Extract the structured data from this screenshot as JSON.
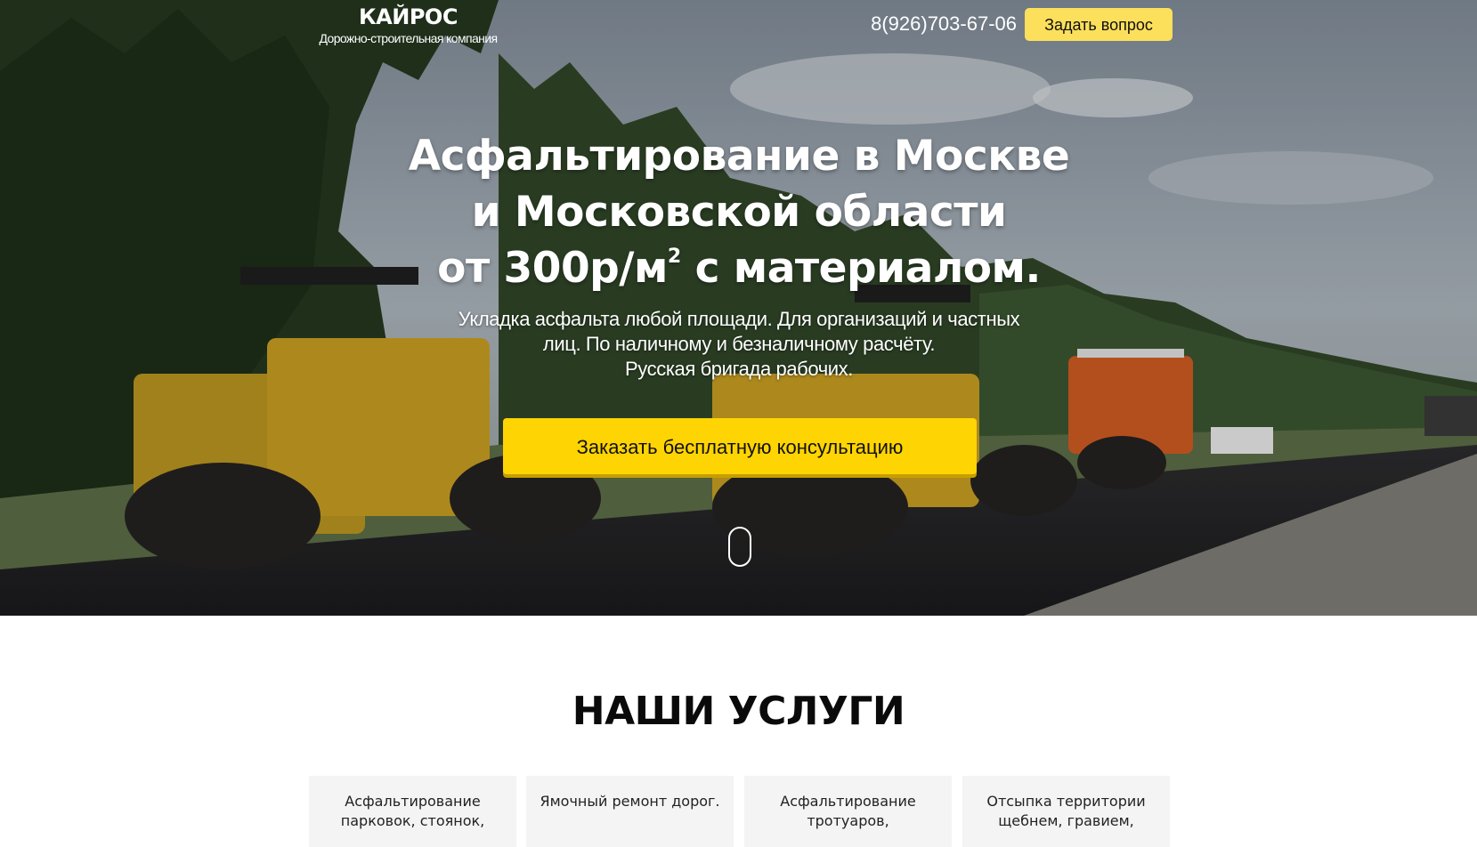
{
  "header": {
    "logo_name": "КАЙРОС",
    "logo_tagline": "Дорожно-строительная компания",
    "phone": "8(926)703-67-06",
    "ask_button": "Задать вопрос"
  },
  "hero": {
    "title_line1": "Асфальтирование  в Москве",
    "title_line2": "и  Московской области",
    "title_line3_prefix": "от 300р/м",
    "title_line3_sup": "2",
    "title_line3_suffix": " с материалом.",
    "subtitle_line1": "Укладка асфальта любой площади. Для организаций и частных",
    "subtitle_line2": "лиц. По наличному и безналичному расчёту.",
    "subtitle_line3": "Русская бригада рабочих.",
    "cta_button": "Заказать бесплатную консультацию",
    "background_description_icon": "road-rollers-photo"
  },
  "services": {
    "title": "НАШИ УСЛУГИ",
    "cards": [
      {
        "line1": "Асфальтирование",
        "line2": "парковок, стоянок,"
      },
      {
        "line1": "Ямочный ремонт дорог.",
        "line2": ""
      },
      {
        "line1": "Асфальтирование",
        "line2": "тротуаров,"
      },
      {
        "line1": "Отсыпка территории",
        "line2": "щебнем,   гравием,"
      }
    ]
  },
  "colors": {
    "accent_yellow": "#ffd403",
    "ask_button_yellow": "#fcdf5b",
    "text_dark": "#0a0a0a",
    "card_bg": "#f4f4f4"
  }
}
